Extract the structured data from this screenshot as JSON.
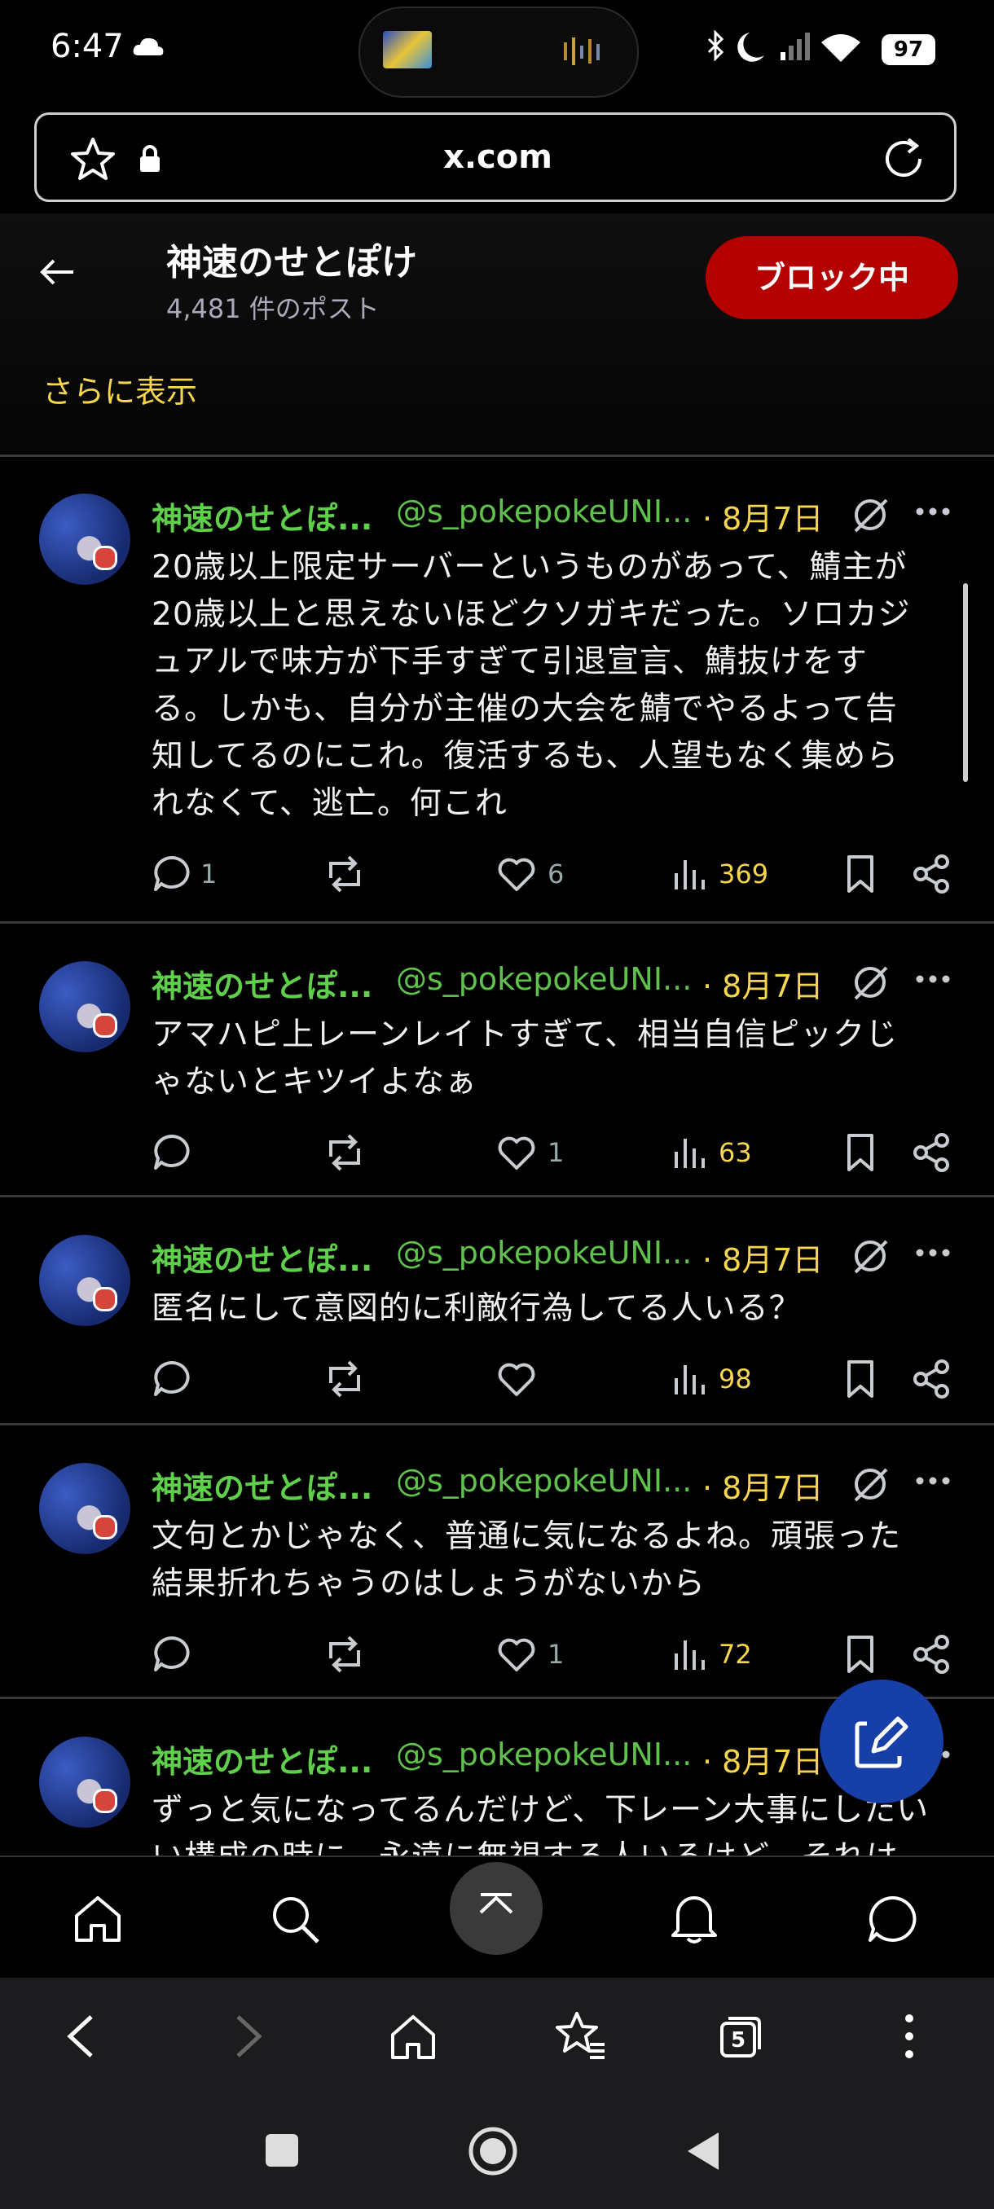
{
  "status_bar": {
    "time": "6:47",
    "battery": "97"
  },
  "browser": {
    "url": "x.com"
  },
  "profile": {
    "name": "神速のせとぽけ",
    "post_count": "4,481 件のポスト",
    "block_label": "ブロック中",
    "show_more": "さらに表示"
  },
  "posts": [
    {
      "name": "神速のせとぽ...",
      "handle": "@s_pokepokeUNI...",
      "date": "· 8月7日",
      "lines": [
        "20歳以上限定サーバーというものがあって、鯖主が",
        "20歳以上と思えないほどクソガキだった。ソロカジ",
        "ュアルで味方が下手すぎて引退宣言、鯖抜けをす",
        "る。しかも、自分が主催の大会を鯖でやるよって告",
        "知してるのにこれ。復活するも、人望もなく集めら",
        "れなくて、逃亡。何これ"
      ],
      "replies": "1",
      "reposts": "",
      "likes": "6",
      "views": "369"
    },
    {
      "name": "神速のせとぽ...",
      "handle": "@s_pokepokeUNI...",
      "date": "· 8月7日",
      "lines": [
        "アマハピ上レーンレイトすぎて、相当自信ピックじ",
        "ゃないとキツイよなぁ"
      ],
      "replies": "",
      "reposts": "",
      "likes": "1",
      "views": "63"
    },
    {
      "name": "神速のせとぽ...",
      "handle": "@s_pokepokeUNI...",
      "date": "· 8月7日",
      "lines": [
        "匿名にして意図的に利敵行為してる人いる？"
      ],
      "replies": "",
      "reposts": "",
      "likes": "",
      "views": "98"
    },
    {
      "name": "神速のせとぽ...",
      "handle": "@s_pokepokeUNI...",
      "date": "· 8月7日",
      "lines": [
        "文句とかじゃなく、普通に気になるよね。頑張った",
        "結果折れちゃうのはしょうがないから"
      ],
      "replies": "",
      "reposts": "",
      "likes": "1",
      "views": "72"
    },
    {
      "name": "神速のせとぽ...",
      "handle": "@s_pokepokeUNI...",
      "date": "· 8月7日",
      "lines": [
        "ずっと気になってるんだけど、下レーン大事にしたい",
        "い構成の時に、永遠に無視する人いるけど、それは"
      ],
      "replies": "",
      "reposts": "",
      "likes": "",
      "views": ""
    }
  ],
  "browser_nav": {
    "tab_count": "5"
  }
}
